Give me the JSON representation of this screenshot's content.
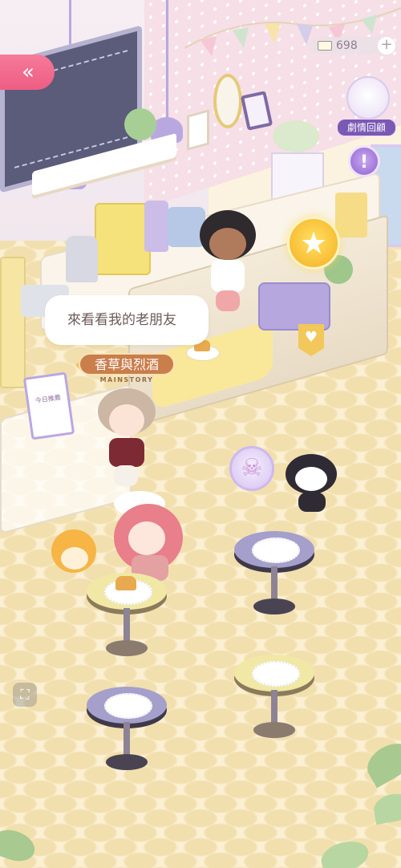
{
  "hud": {
    "back_glyph": "«",
    "currency_value": "698",
    "add_glyph": "+",
    "story_recap_label": "劇情回顧",
    "alert_glyph": "!",
    "star_glyph": "★",
    "heart_glyph": "♥",
    "camera_glyph": "⛶",
    "skull_glyph": "☠"
  },
  "dialogue": {
    "speech_text": "來看看我的老朋友",
    "story_tag_title": "香草與烈酒",
    "story_tag_subtitle": "MAINSTORY"
  },
  "scene": {
    "sign_text": "今日推薦"
  }
}
